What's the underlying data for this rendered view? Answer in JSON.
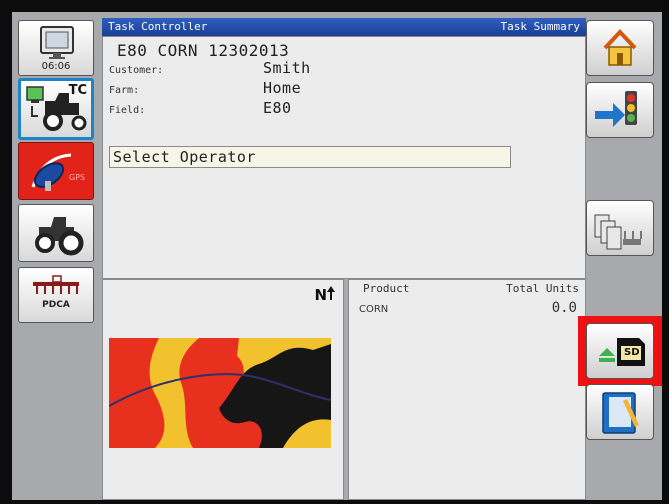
{
  "clock": "06:06",
  "tc_label": "TC",
  "gps_label": "GPS",
  "pdca_label": "PDCA",
  "title_bar": {
    "left": "Task Controller",
    "right": "Task Summary"
  },
  "task": {
    "name": "E80 CORN 12302013",
    "fields": [
      {
        "label": "Customer:",
        "value": "Smith"
      },
      {
        "label": "Farm:",
        "value": "Home"
      },
      {
        "label": "Field:",
        "value": "E80"
      }
    ],
    "operator_select": "Select Operator"
  },
  "map": {
    "north_label": "N"
  },
  "products": {
    "headers": {
      "product": "Product",
      "total_units": "Total Units"
    },
    "rows": [
      {
        "name": "CORN",
        "total": "0.0"
      }
    ]
  },
  "sd_label": "SD",
  "colors": {
    "title_bar": "#1f4aa8",
    "highlight": "#ee1111",
    "gps_button": "#e2231a",
    "active_border": "#1e84c8"
  },
  "icons": {
    "left": [
      "display-clock-icon",
      "task-controller-icon",
      "gps-satellite-icon",
      "tractor-icon",
      "pdca-implement-icon"
    ],
    "right": [
      "home-icon",
      "exit-traffic-light-icon",
      "field-features-icon",
      "sd-card-icon",
      "notebook-icon"
    ]
  }
}
